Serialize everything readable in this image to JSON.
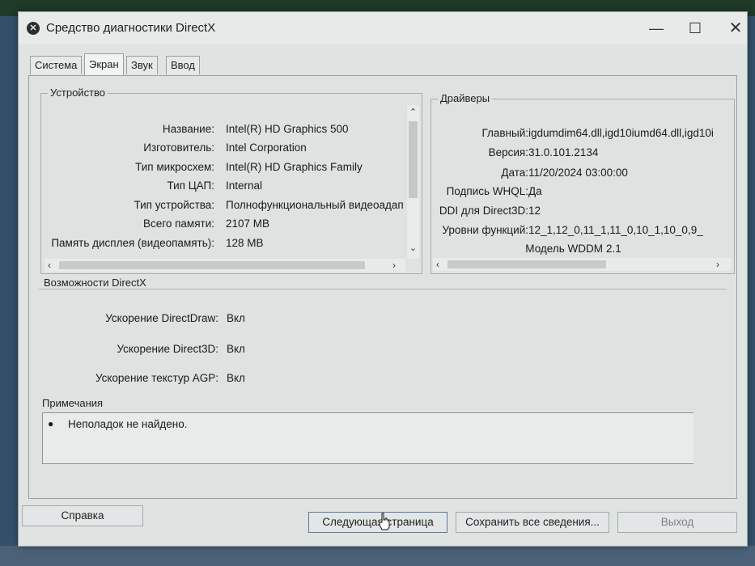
{
  "window": {
    "title": "Средство диагностики DirectX",
    "controls": {
      "minimize": "—",
      "maximize": "☐",
      "close": "✕"
    }
  },
  "tabs": [
    {
      "label": "Система",
      "active": false
    },
    {
      "label": "Экран",
      "active": true
    },
    {
      "label": "Звук",
      "active": false
    },
    {
      "label": "Ввод",
      "active": false
    }
  ],
  "device": {
    "title": "Устройство",
    "rows": [
      {
        "label": "Название:",
        "value": "Intel(R) HD Graphics 500"
      },
      {
        "label": "Изготовитель:",
        "value": "Intel Corporation"
      },
      {
        "label": "Тип микросхем:",
        "value": "Intel(R) HD Graphics Family"
      },
      {
        "label": "Тип ЦАП:",
        "value": "Internal"
      },
      {
        "label": "Тип устройства:",
        "value": "Полнофункциональный видеоадап"
      },
      {
        "label": "Всего памяти:",
        "value": "2107 MB"
      },
      {
        "label": "Память дисплея (видеопамять):",
        "value": "128 MB"
      }
    ]
  },
  "drivers": {
    "title": "Драйверы",
    "rows": [
      {
        "label": "Главный:",
        "value": "igdumdim64.dll,igd10iumd64.dll,igd10i"
      },
      {
        "label": "Версия:",
        "value": "31.0.101.2134"
      },
      {
        "label": "Дата:",
        "value": "11/20/2024 03:00:00"
      },
      {
        "label": "Подпись WHQL:",
        "value": "Да"
      },
      {
        "label": "DDI для Direct3D:",
        "value": "12"
      },
      {
        "label": "Уровни функций:",
        "value": "12_1,12_0,11_1,11_0,10_1,10_0,9_"
      },
      {
        "label": "Модель WDDM",
        "value": "2.1"
      }
    ]
  },
  "directx": {
    "title": "Возможности DirectX",
    "rows": [
      {
        "label": "Ускорение DirectDraw:",
        "value": "Вкл"
      },
      {
        "label": "Ускорение Direct3D:",
        "value": "Вкл"
      },
      {
        "label": "Ускорение текстур AGP:",
        "value": "Вкл"
      }
    ]
  },
  "notes": {
    "title": "Примечания",
    "items": [
      "Неполадок не найдено."
    ]
  },
  "buttons": {
    "help": "Справка",
    "next": "Следующая страница",
    "save": "Сохранить все сведения...",
    "exit": "Выход"
  },
  "icons": {
    "app": "directx-icon",
    "scroll_up": "chevron-up-icon",
    "scroll_down": "chevron-down-icon",
    "scroll_left": "chevron-left-icon",
    "scroll_right": "chevron-right-icon"
  }
}
